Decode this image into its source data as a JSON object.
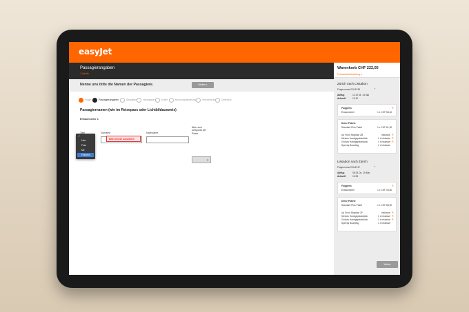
{
  "app": {
    "logo": "easyJet"
  },
  "header": {
    "title": "Passagierangaben",
    "subtitle": "1 Adulte"
  },
  "notice": {
    "text": "Nenne uns bitte die Namen der Passagiere.",
    "weiter_label": "Weiter ▸"
  },
  "steps": [
    {
      "label": "Flüge",
      "state": "done"
    },
    {
      "label": "Passagierangaben",
      "state": "active"
    },
    {
      "label": "Sitzplätze",
      "state": "pending"
    },
    {
      "label": "Handgepäck",
      "state": "pending"
    },
    {
      "label": "Koffer",
      "state": "pending"
    },
    {
      "label": "Buchungsänderung",
      "state": "pending"
    },
    {
      "label": "Versicherung",
      "state": "pending"
    },
    {
      "label": "Überblick",
      "state": "pending"
    }
  ],
  "form": {
    "section_title": "Passagiernamen (wie im Reisepass oder Lichtbildausweis)",
    "adult_label": "Erwachsener 1",
    "title_label": "Titel",
    "firstname_label": "Vorname",
    "lastname_label": "Nachname",
    "age_label": "Alter zum Zeitpunkt der Reise",
    "error": "Bitte Anrede auswählen",
    "title_options": [
      "Herr",
      "Frau",
      "Mx",
      "Fräulein"
    ],
    "title_selected": "Fräulein"
  },
  "cart": {
    "title": "Warenkorb CHF 222,05",
    "link": "Preisaufschlüsselung ▸",
    "outbound": {
      "title": "Zürich nach Lissabon",
      "flight_no": "Flugnummer EJU6748",
      "depart_label": "Abflug",
      "depart_value": "11:10 Mi. 14 Mai",
      "arrive_label": "Ankunft",
      "arrive_value": "13:10",
      "fare_title": "Flugpreis",
      "fare_row": "Erwachsener",
      "fare_value": "1 x CHF 58,40",
      "pkg_title": "Deine Pakete",
      "pkg_row": "Standard Plus Paket",
      "pkg_value": "1 x CHF 61,90",
      "items": [
        {
          "label": "Up Front Sitzplatz 2B",
          "value": "Inklusive"
        },
        {
          "label": "Kleines Handgepäckstück",
          "value": "1 x Inklusive"
        },
        {
          "label": "Großes Handgepäckstück",
          "value": "1 x Inklusive"
        },
        {
          "label": "Speedy Boarding",
          "value": "1 x Inklusive"
        }
      ]
    },
    "inbound": {
      "title": "Lissabon nach Zürich",
      "flight_no": "Flugnummer EJU6747",
      "depart_label": "Abflug",
      "depart_value": "08:15 Do. 15 Mai",
      "arrive_label": "Ankunft",
      "arrive_value": "10:05",
      "fare_title": "Flugpreis",
      "fare_row": "Erwachsener",
      "fare_value": "1 x CHF 34,80",
      "pkg_title": "Deine Pakete",
      "pkg_row": "Standard Plus Paket",
      "pkg_value": "1 x CHF 68,90",
      "items": [
        {
          "label": "Up Front Sitzplatz 2F",
          "value": "Inklusive"
        },
        {
          "label": "Kleines Handgepäckstück",
          "value": "1 x Inklusive"
        },
        {
          "label": "Großes Handgepäckstück",
          "value": "1 x Inklusive"
        },
        {
          "label": "Speedy Boarding",
          "value": "1 x Inklusive"
        }
      ]
    },
    "weiter_label": "Weiter"
  }
}
